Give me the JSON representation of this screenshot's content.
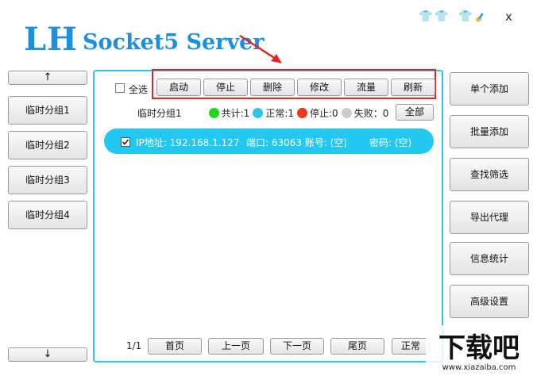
{
  "header": {
    "logo_main": "LH",
    "logo_sub": "Socket5 Server",
    "close_label": "x",
    "icons": [
      "skin-orange-icon",
      "skin-blue-icon",
      "skin-black-icon",
      "brush-icon"
    ]
  },
  "left": {
    "up_label": "↑",
    "down_label": "↓",
    "groups": [
      "临时分组1",
      "临时分组2",
      "临时分组3",
      "临时分组4"
    ]
  },
  "toolbar": {
    "select_all": "全选",
    "start": "启动",
    "stop": "停止",
    "delete": "删除",
    "edit": "修改",
    "traffic": "流量",
    "refresh": "刷新"
  },
  "status": {
    "group_name": "临时分组1",
    "total": "共计:1",
    "normal": "正常:1",
    "stopped": "停止:0",
    "failed": "失败：0",
    "all_button": "全部",
    "colors": {
      "total": "#22d41c",
      "normal": "#2fc4e8",
      "stopped": "#e83a1c",
      "failed": "#cccccc"
    }
  },
  "proxy_row": {
    "checked": true,
    "ip": "IP地址: 192.168.1.127",
    "port_account": "端口: 63063 账号:  (空)",
    "password": "密码:  (空)"
  },
  "pagination": {
    "page": "1/1",
    "first": "首页",
    "prev": "上一页",
    "next": "下一页",
    "last": "尾页",
    "mode": "正常"
  },
  "right": {
    "items": [
      "单个添加",
      "批量添加",
      "查找筛选",
      "导出代理",
      "信息统计",
      "高级设置"
    ]
  },
  "watermark": {
    "brand": "下载吧",
    "url": "www.xiazaiba.com"
  }
}
